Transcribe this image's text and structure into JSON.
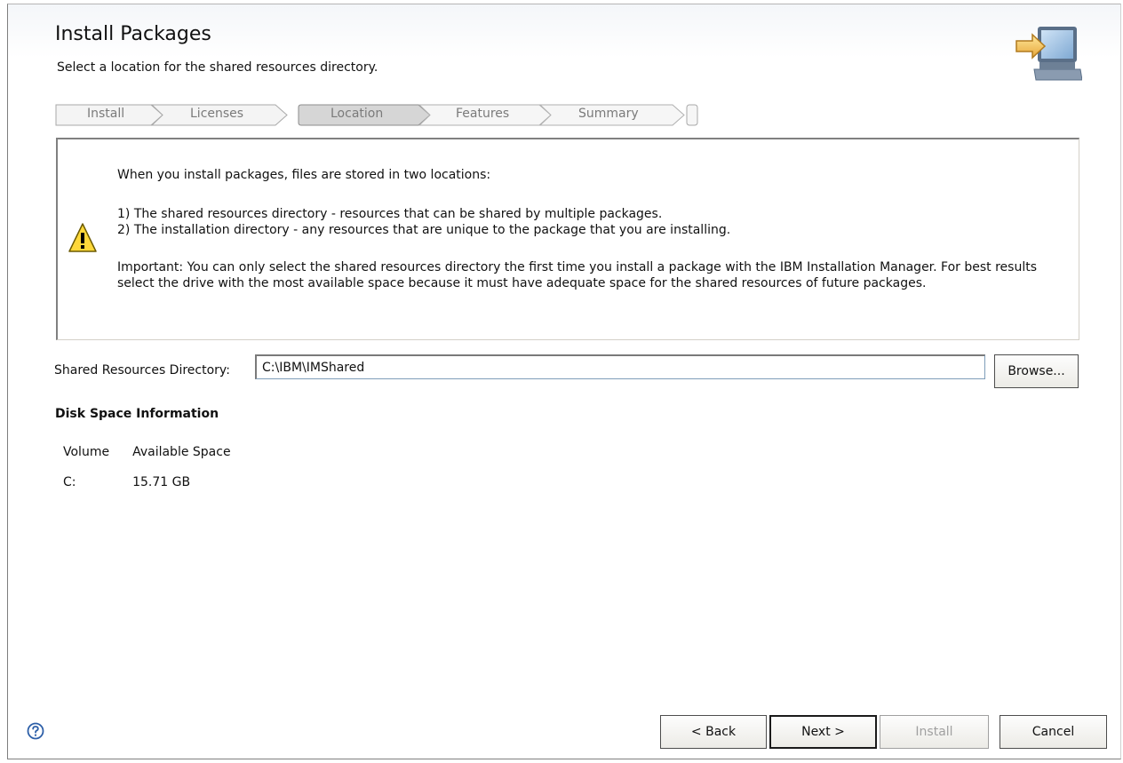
{
  "header": {
    "title": "Install Packages",
    "subtitle": "Select a location for the shared resources directory."
  },
  "steps": [
    {
      "label": "Install",
      "state": "done"
    },
    {
      "label": "Licenses",
      "state": "done"
    },
    {
      "label": "Location",
      "state": "active"
    },
    {
      "label": "Features",
      "state": "pending"
    },
    {
      "label": "Summary",
      "state": "pending"
    }
  ],
  "info": {
    "line1": "When you install packages, files are stored in two locations:",
    "line2": "1) The shared resources directory - resources that can be shared by multiple packages.",
    "line3": "2) The installation directory - any resources that are unique to the package that you are installing.",
    "line4": "Important: You can only select the shared resources directory the first time you install a package with the IBM Installation Manager. For best results select the drive with the most available space because it must have adequate space for the shared resources of future packages."
  },
  "shared_dir": {
    "label": "Shared Resources Directory:",
    "value": "C:\\IBM\\IMShared",
    "browse_label": "Browse..."
  },
  "disk": {
    "heading": "Disk Space Information",
    "columns": [
      "Volume",
      "Available Space"
    ],
    "rows": [
      [
        "C:",
        "15.71 GB"
      ]
    ]
  },
  "footer": {
    "back_label": "< Back",
    "next_label": "Next >",
    "install_label": "Install",
    "cancel_label": "Cancel"
  },
  "icons": {
    "help": "help-icon",
    "warning": "warning-icon",
    "banner": "computer-arrow-icon"
  }
}
